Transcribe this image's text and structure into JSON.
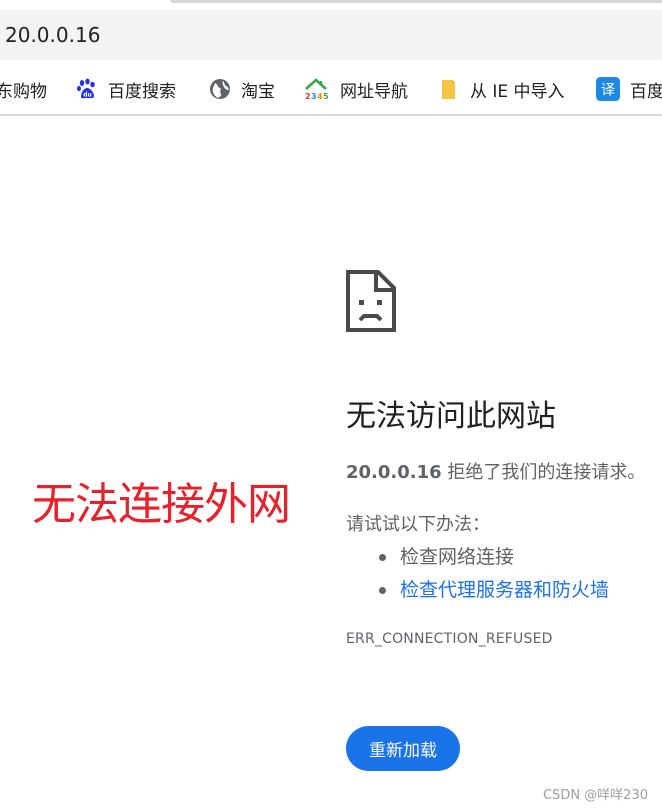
{
  "browser": {
    "address_bar": {
      "url": "20.0.0.16"
    },
    "bookmarks": [
      {
        "label": "东购物",
        "icon": "none"
      },
      {
        "label": "百度搜索",
        "icon": "baidu-paw-icon"
      },
      {
        "label": "淘宝",
        "icon": "globe-icon"
      },
      {
        "label": "网址导航",
        "icon": "2345-house-icon"
      },
      {
        "label": "从 IE 中导入",
        "icon": "folder-icon"
      },
      {
        "label": "百度",
        "icon": "translate-icon"
      }
    ]
  },
  "error_page": {
    "icon": "sad-document-icon",
    "title": "无法访问此网站",
    "host": "20.0.0.16",
    "description_suffix": " 拒绝了我们的连接请求。",
    "suggestions_heading": "请试试以下办法：",
    "suggestions": [
      {
        "label": "检查网络连接",
        "is_link": false
      },
      {
        "label": "检查代理服务器和防火墙",
        "is_link": true
      }
    ],
    "error_code": "ERR_CONNECTION_REFUSED",
    "reload_button": "重新加载"
  },
  "annotation": {
    "text": "无法连接外网",
    "color": "#e8202a"
  },
  "watermark": "CSDN @咩咩230",
  "colors": {
    "link": "#1a73e8",
    "button": "#1a73e8",
    "text_secondary": "#5f6368",
    "omnibox_bg": "#f1f3f4"
  }
}
